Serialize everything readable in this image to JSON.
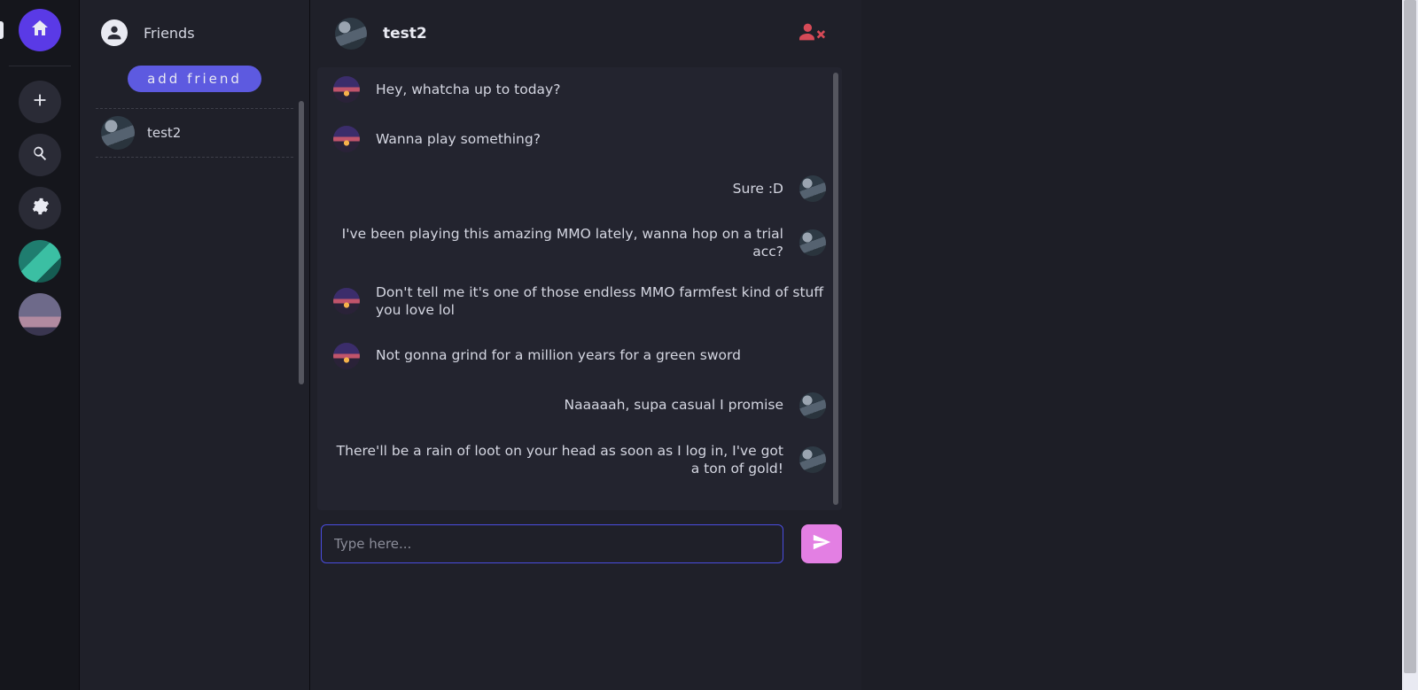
{
  "rail": {
    "icons": [
      "home-icon",
      "plus-icon",
      "search-icon",
      "gear-icon"
    ],
    "servers": [
      "server-teal",
      "server-dusk"
    ]
  },
  "sidebar": {
    "title": "Friends",
    "add_friend_label": "add friend",
    "friends": [
      {
        "name": "test2",
        "avatar": "mount"
      }
    ]
  },
  "chat": {
    "partner_name": "test2",
    "partner_avatar": "mount",
    "messages": [
      {
        "side": "left",
        "avatar": "sunset",
        "text": "Hey, whatcha up to today?"
      },
      {
        "side": "left",
        "avatar": "sunset",
        "text": "Wanna play something?"
      },
      {
        "side": "right",
        "avatar": "mount",
        "text": "Sure :D"
      },
      {
        "side": "right",
        "avatar": "mount",
        "text": "I've been playing this amazing MMO lately, wanna hop on a trial acc?"
      },
      {
        "side": "left",
        "avatar": "sunset",
        "text": "Don't tell me it's one of those endless MMO farmfest kind of stuff you love lol"
      },
      {
        "side": "left",
        "avatar": "sunset",
        "text": "Not gonna grind for a million years for a green sword"
      },
      {
        "side": "right",
        "avatar": "mount",
        "text": "Naaaaah, supa casual I promise"
      },
      {
        "side": "right",
        "avatar": "mount",
        "text": "There'll be a rain of loot on your head as soon as I log in, I've got a ton of gold!"
      }
    ],
    "input_placeholder": "Type here..."
  },
  "colors": {
    "accent": "#5a3ae6",
    "pill": "#5d5ae0",
    "send": "#e37fe3",
    "remove": "#d64a57"
  }
}
